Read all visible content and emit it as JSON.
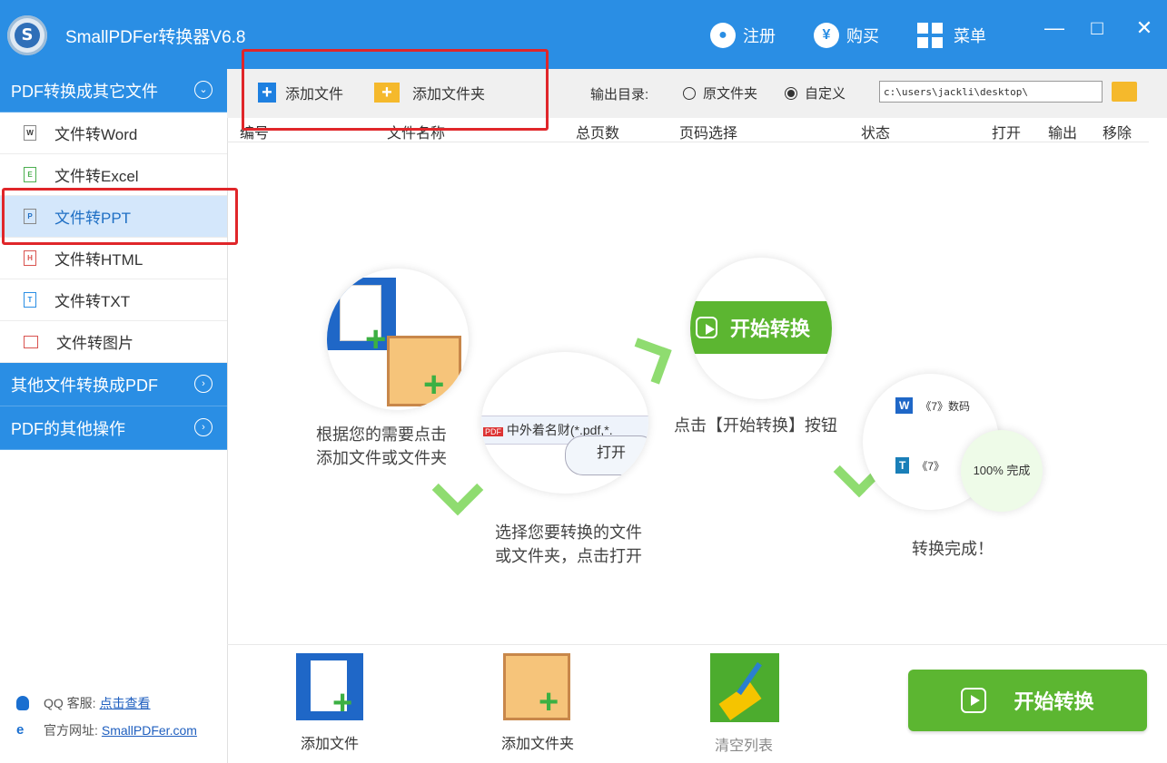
{
  "app": {
    "title": "SmallPDFer转换器V6.8",
    "logo_letter": "S"
  },
  "titlebar": {
    "register_label": "注册",
    "buy_label": "购买",
    "menu_label": "菜单",
    "minimize": "—",
    "maximize": "□",
    "close": "✕"
  },
  "sidebar": {
    "category_pdf_to_other": "PDF转换成其它文件",
    "items": [
      {
        "label": "文件转Word",
        "icon": "W"
      },
      {
        "label": "文件转Excel",
        "icon": "E"
      },
      {
        "label": "文件转PPT",
        "icon": "P"
      },
      {
        "label": "文件转HTML",
        "icon": "H"
      },
      {
        "label": "文件转TXT",
        "icon": "T"
      },
      {
        "label": "文件转图片",
        "icon": ""
      }
    ],
    "category_other_to_pdf": "其他文件转换成PDF",
    "category_pdf_ops": "PDF的其他操作",
    "support_qq_label": "QQ 客服:",
    "support_qq_link": "点击查看",
    "support_site_label": "官方网址:",
    "support_site_link": "SmallPDFer.com"
  },
  "toolbar": {
    "add_file": "添加文件",
    "add_folder": "添加文件夹",
    "output_label": "输出目录:",
    "radio_original": "原文件夹",
    "radio_custom": "自定义",
    "path_value": "c:\\users\\jackli\\desktop\\"
  },
  "table_header": {
    "col_no": "编号",
    "col_name": "文件名称",
    "col_pages": "总页数",
    "col_page_select": "页码选择",
    "col_status": "状态",
    "col_open": "打开",
    "col_output": "输出",
    "col_remove": "移除"
  },
  "guide": {
    "step1": [
      "根据您的需要点击",
      "添加文件或文件夹"
    ],
    "step2": [
      "选择您要转换的文件",
      "或文件夹，点击打开"
    ],
    "step2_file": "中外着名财",
    "step2_filter": "(*.pdf,*.",
    "step2_open": "打开",
    "step3_button": "开始转换",
    "step3": "点击【开始转换】按钮",
    "step4_row1": "《7》数码",
    "step4_row2": "《7》",
    "step4_progress": "100%  完成",
    "step4": "转换完成！"
  },
  "bottom": {
    "add_file": "添加文件",
    "add_folder": "添加文件夹",
    "clear_list": "清空列表",
    "start": "开始转换"
  },
  "colors": {
    "primary": "#2a8ee4",
    "start_green": "#5cb631",
    "highlight_red": "#e0262a"
  }
}
